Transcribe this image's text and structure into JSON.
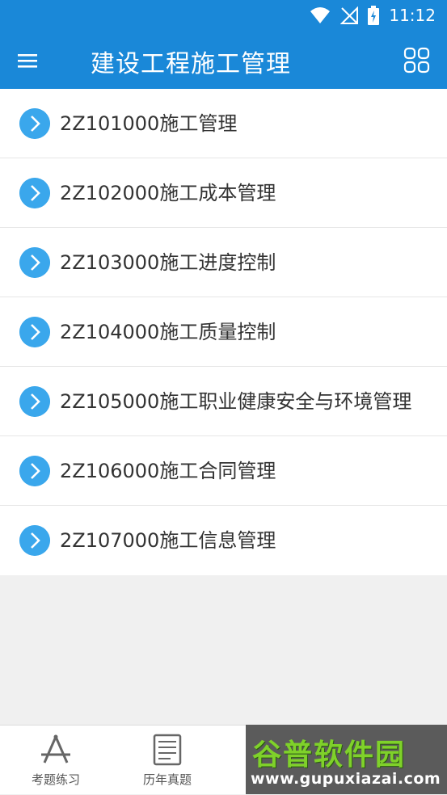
{
  "status": {
    "time": "11:12"
  },
  "appbar": {
    "title": "建设工程施工管理"
  },
  "chapters": [
    {
      "label": "2Z101000施工管理"
    },
    {
      "label": "2Z102000施工成本管理"
    },
    {
      "label": "2Z103000施工进度控制"
    },
    {
      "label": "2Z104000施工质量控制"
    },
    {
      "label": "2Z105000施工职业健康安全与环境管理"
    },
    {
      "label": "2Z106000施工合同管理"
    },
    {
      "label": "2Z107000施工信息管理"
    }
  ],
  "tabs": [
    {
      "label": "考题练习",
      "icon": "compass-icon"
    },
    {
      "label": "历年真题",
      "icon": "document-icon"
    }
  ],
  "watermark": {
    "logo": "谷普软件园",
    "url": "www.gupuxiazai.com"
  },
  "colors": {
    "primary": "#1a88d8",
    "chevron": "#3aa7ec",
    "logo_green": "#7fd12a"
  }
}
